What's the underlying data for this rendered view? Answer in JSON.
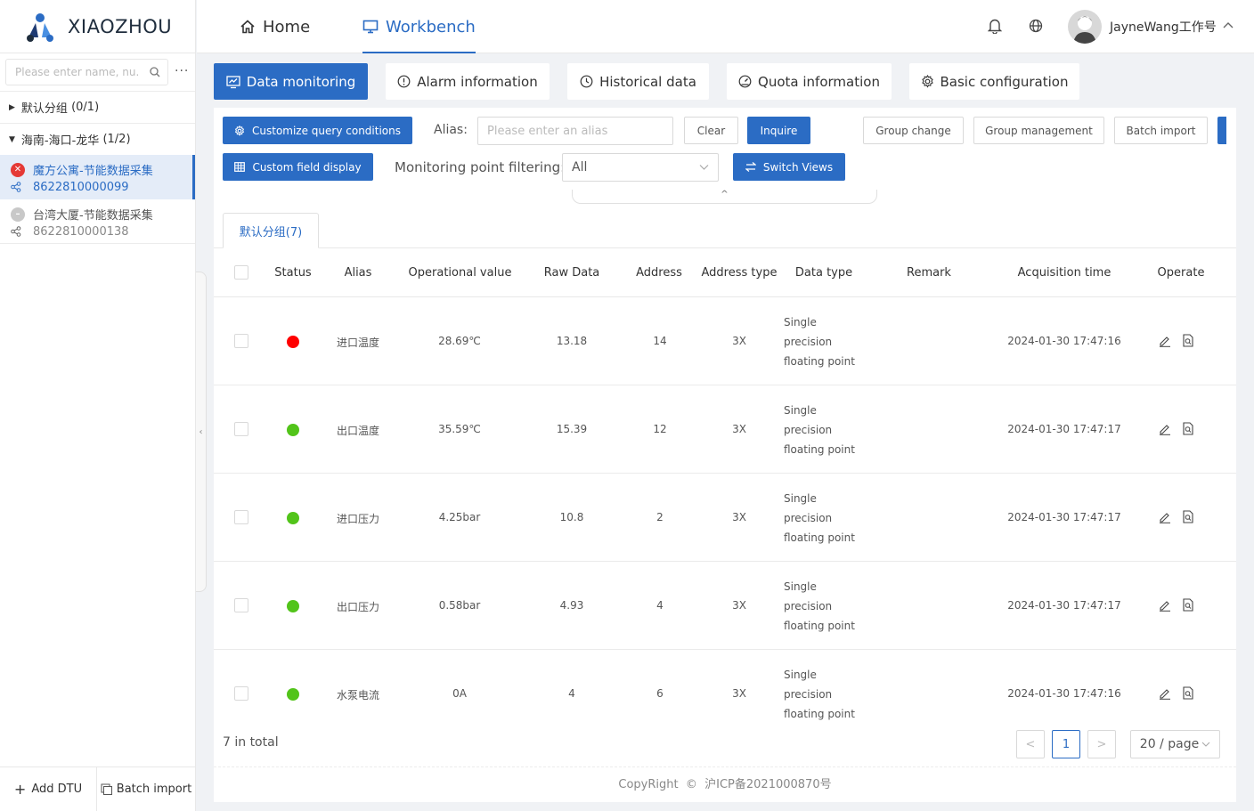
{
  "brand": {
    "name": "XIAOZHOU"
  },
  "sidebar": {
    "search_placeholder": "Please enter name, nu...",
    "more": "···",
    "groups": [
      {
        "label": "默认分组",
        "count": "(0/1)",
        "expanded": false
      },
      {
        "label": "海南-海口-龙华",
        "count": "(1/2)",
        "expanded": true
      }
    ],
    "devices": [
      {
        "name": "魔方公寓-节能数据采集",
        "number": "8622810000099",
        "status": "alarm",
        "selected": true
      },
      {
        "name": "台湾大厦-节能数据采集",
        "number": "8622810000138",
        "status": "offline",
        "selected": false
      }
    ],
    "add_dtu": "Add DTU",
    "batch_import": "Batch import"
  },
  "header": {
    "nav": [
      {
        "label": "Home",
        "icon": "home-icon",
        "active": false
      },
      {
        "label": "Workbench",
        "icon": "monitor-icon",
        "active": true
      }
    ],
    "user": "JayneWang工作号"
  },
  "function_tabs": [
    {
      "label": "Data monitoring",
      "icon": "monitor-chart-icon",
      "active": true
    },
    {
      "label": "Alarm information",
      "icon": "alert-circle-icon",
      "active": false
    },
    {
      "label": "Historical data",
      "icon": "clock-icon",
      "active": false
    },
    {
      "label": "Quota information",
      "icon": "dashboard-icon",
      "active": false
    },
    {
      "label": "Basic configuration",
      "icon": "gear-icon",
      "active": false
    }
  ],
  "toolbar": {
    "customize_query": "Customize query conditions",
    "alias_label": "Alias:",
    "alias_placeholder": "Please enter an alias",
    "clear": "Clear",
    "inquire": "Inquire",
    "group_change": "Group change",
    "group_management": "Group management",
    "batch_import": "Batch import",
    "custom_field": "Custom field display",
    "filter_label": "Monitoring point filtering:",
    "filter_value": "All",
    "switch_views": "Switch Views",
    "fold": "^"
  },
  "group_tab": "默认分组(7)",
  "table": {
    "columns": [
      "Status",
      "Alias",
      "Operational value",
      "Raw Data",
      "Address",
      "Address type",
      "Data type",
      "Remark",
      "Acquisition time",
      "Operate"
    ],
    "rows": [
      {
        "status": "alarm",
        "alias": "进口温度",
        "value": "28.69℃",
        "raw": "13.18",
        "address": "14",
        "addr_type": "3X",
        "dtype": [
          "Single",
          "precision",
          "floating point"
        ],
        "remark": "",
        "time": "2024-01-30 17:47:16"
      },
      {
        "status": "normal",
        "alias": "出口温度",
        "value": "35.59℃",
        "raw": "15.39",
        "address": "12",
        "addr_type": "3X",
        "dtype": [
          "Single",
          "precision",
          "floating point"
        ],
        "remark": "",
        "time": "2024-01-30 17:47:17"
      },
      {
        "status": "normal",
        "alias": "进口压力",
        "value": "4.25bar",
        "raw": "10.8",
        "address": "2",
        "addr_type": "3X",
        "dtype": [
          "Single",
          "precision",
          "floating point"
        ],
        "remark": "",
        "time": "2024-01-30 17:47:17"
      },
      {
        "status": "normal",
        "alias": "出口压力",
        "value": "0.58bar",
        "raw": "4.93",
        "address": "4",
        "addr_type": "3X",
        "dtype": [
          "Single",
          "precision",
          "floating point"
        ],
        "remark": "",
        "time": "2024-01-30 17:47:17"
      },
      {
        "status": "normal",
        "alias": "水泵电流",
        "value": "0A",
        "raw": "4",
        "address": "6",
        "addr_type": "3X",
        "dtype": [
          "Single",
          "precision",
          "floating point"
        ],
        "remark": "",
        "time": "2024-01-30 17:47:16"
      }
    ]
  },
  "pagination": {
    "total": "7 in total",
    "prev": "<",
    "page": "1",
    "next": ">",
    "page_size": "20 / page"
  },
  "footer": {
    "copyright": "CopyRight",
    "icp": "沪ICP备2021000870号"
  },
  "colors": {
    "primary": "#2b6cc4",
    "alarm": "#ff0000",
    "normal": "#52c41a",
    "offline": "#c8c8c8"
  }
}
